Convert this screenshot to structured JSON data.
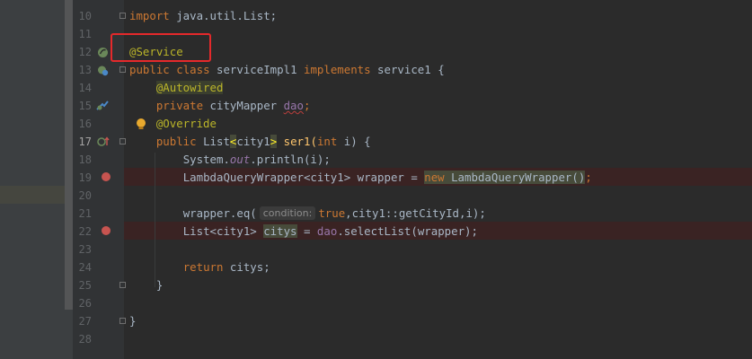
{
  "editor": {
    "lines": [
      {
        "num": "10",
        "code": "import java.util.List;"
      },
      {
        "num": "11",
        "code": ""
      },
      {
        "num": "12",
        "code": "@Service"
      },
      {
        "num": "13",
        "code": "public class serviceImpl1 implements service1 {"
      },
      {
        "num": "14",
        "code": "    @Autowired"
      },
      {
        "num": "15",
        "code": "    private cityMapper dao;"
      },
      {
        "num": "16",
        "code": "    @Override"
      },
      {
        "num": "17",
        "code": "    public List<city1> ser1(int i) {"
      },
      {
        "num": "18",
        "code": "        System.out.println(i);"
      },
      {
        "num": "19",
        "code": "        LambdaQueryWrapper<city1> wrapper = new LambdaQueryWrapper();"
      },
      {
        "num": "20",
        "code": ""
      },
      {
        "num": "21",
        "code": "        wrapper.eq( condition: true,city1::getCityId,i);"
      },
      {
        "num": "22",
        "code": "        List<city1> citys = dao.selectList(wrapper);"
      },
      {
        "num": "23",
        "code": ""
      },
      {
        "num": "24",
        "code": "        return citys;"
      },
      {
        "num": "25",
        "code": "    }"
      },
      {
        "num": "26",
        "code": ""
      },
      {
        "num": "27",
        "code": "}"
      },
      {
        "num": "28",
        "code": ""
      }
    ],
    "tokens": {
      "import_kw": "import",
      "import_rest": " java.util.List;",
      "service_ann": "@Service",
      "public_kw": "public",
      "class_kw": "class",
      "class_name": " serviceImpl1 ",
      "implements_kw": "implements",
      "iface": " service1 {",
      "autowired_ann": "@Autowired",
      "private_kw": "private",
      "mapper_type": " cityMapper ",
      "dao_field": "dao",
      "semicolon": ";",
      "override_ann": "@Override",
      "public_kw2": "public",
      "list_type": " List",
      "lt": "<",
      "city1_generic": "city1",
      "gt": ">",
      "method_sig": " ser1(",
      "int_kw": "int",
      "param": " i) {",
      "system": "System.",
      "out_field": "out",
      "println": ".println(i);",
      "lqw_decl": "LambdaQueryWrapper<city1> wrapper = ",
      "new_kw": "new",
      "lqw_new": " LambdaQueryWrapper",
      "parens": "()",
      "semi2": ";",
      "eq_call": "wrapper.eq(",
      "hint_condition": "condition:",
      "true_kw": "true",
      "eq_rest": ",city1::getCityId,i);",
      "list_decl": "List<city1> ",
      "citys_var": "citys",
      "assign": " = ",
      "dao_field2": "dao",
      "select_call": ".selectList(wrapper);",
      "return_kw": "return",
      "return_rest": " citys;",
      "close_brace_method": "}",
      "close_brace_class": "}"
    }
  },
  "gutter_icons": [
    "spring-bean-icon",
    "spring-class-icon",
    "autowired-injection-icon",
    "intention-bulb-icon",
    "override-method-icon",
    "breakpoint-icon"
  ],
  "colors": {
    "background": "#2b2b2b",
    "keyword": "#cc7832",
    "annotation": "#bbb529",
    "field": "#9876aa",
    "text": "#a9b7c6",
    "breakpoint": "#c75450",
    "highlight_box": "#e5292b"
  }
}
